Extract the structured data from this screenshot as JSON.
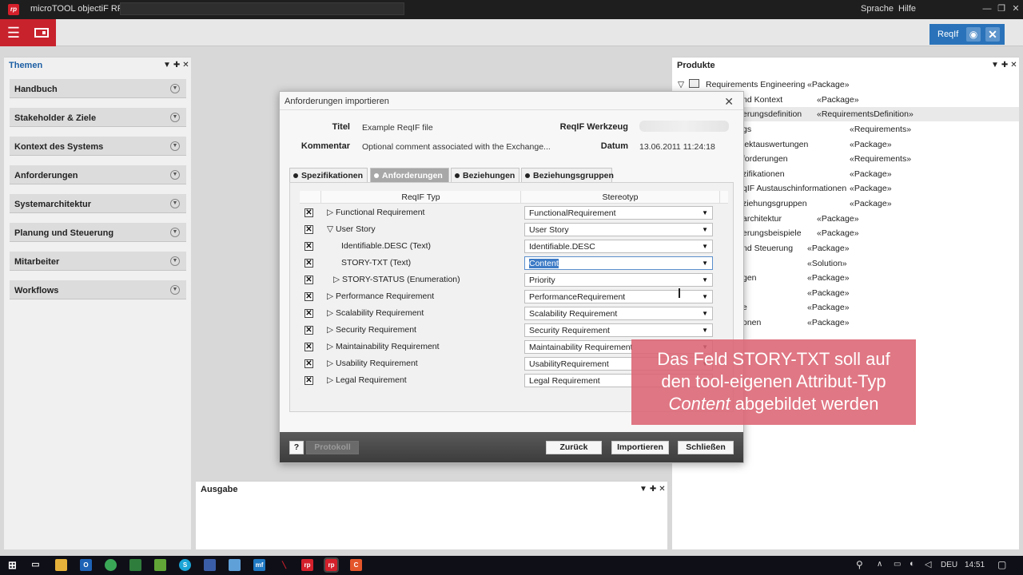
{
  "app": {
    "title": "microTOOL objectiF RPM",
    "logo": "rp"
  },
  "titlebar": {
    "menu_language": "Sprache",
    "menu_help": "Hilfe"
  },
  "toolbar": {
    "reqif_tab": "ReqIf"
  },
  "themen": {
    "title": "Themen",
    "items": [
      {
        "label": "Handbuch"
      },
      {
        "label": "Stakeholder & Ziele"
      },
      {
        "label": "Kontext des Systems"
      },
      {
        "label": "Anforderungen"
      },
      {
        "label": "Systemarchitektur"
      },
      {
        "label": "Planung und Steuerung"
      },
      {
        "label": "Mitarbeiter"
      },
      {
        "label": "Workflows"
      }
    ]
  },
  "produkte": {
    "title": "Produkte",
    "rows": [
      {
        "name": "Requirements Engineering",
        "stereo": "«Package»"
      },
      {
        "name": "nd Kontext",
        "stereo": "«Package»"
      },
      {
        "name": "erungsdefinition",
        "stereo": "«RequirementsDefinition»"
      },
      {
        "name": "gs",
        "stereo": "«Requirements»"
      },
      {
        "name": "jektauswertungen",
        "stereo": "«Package»"
      },
      {
        "name": "forderungen",
        "stereo": "«Requirements»"
      },
      {
        "name": "zifikationen",
        "stereo": "«Package»"
      },
      {
        "name": "qIF Austauschinformationen",
        "stereo": "«Package»"
      },
      {
        "name": "ziehungsgruppen",
        "stereo": "«Package»"
      },
      {
        "name": "architektur",
        "stereo": "«Package»"
      },
      {
        "name": "erungsbeispiele",
        "stereo": "«Package»"
      },
      {
        "name": "nd Steuerung",
        "stereo": "«Package»"
      },
      {
        "name": "",
        "stereo": "«Solution»"
      },
      {
        "name": "gen",
        "stereo": "«Package»"
      },
      {
        "name": "",
        "stereo": "«Package»"
      },
      {
        "name": "e",
        "stereo": "«Package»"
      },
      {
        "name": "onen",
        "stereo": "«Package»"
      }
    ]
  },
  "ausgabe": {
    "title": "Ausgabe"
  },
  "dialog": {
    "title": "Anforderungen importieren",
    "fields": {
      "title_label": "Titel",
      "title_value": "Example ReqIF file",
      "comment_label": "Kommentar",
      "comment_value": "Optional comment associated with the Exchange...",
      "tool_label": "ReqIF Werkzeug",
      "date_label": "Datum",
      "date_value": "13.06.2011 11:24:18"
    },
    "tabs": [
      {
        "label": "Spezifikationen"
      },
      {
        "label": "Anforderungen",
        "active": true
      },
      {
        "label": "Beziehungen"
      },
      {
        "label": "Beziehungsgruppen"
      }
    ],
    "table": {
      "col_type": "ReqIF Typ",
      "col_stereo": "Stereotyp",
      "rows": [
        {
          "type": "▷ Functional Requirement",
          "stereo": "FunctionalRequirement"
        },
        {
          "type": "▽ User Story",
          "stereo": "User Story"
        },
        {
          "type": "Identifiable.DESC (Text)",
          "stereo": "Identifiable.DESC"
        },
        {
          "type": "STORY-TXT (Text)",
          "stereo": "Content"
        },
        {
          "type": "▷ STORY-STATUS (Enumeration)",
          "stereo": "Priority"
        },
        {
          "type": "▷ Performance Requirement",
          "stereo": "PerformanceRequirement"
        },
        {
          "type": "▷ Scalability Requirement",
          "stereo": "Scalability Requirement"
        },
        {
          "type": "▷ Security Requirement",
          "stereo": "Security Requirement"
        },
        {
          "type": "▷ Maintainability Requirement",
          "stereo": "Maintainability Requirement"
        },
        {
          "type": "▷ Usability Requirement",
          "stereo": "UsabilityRequirement"
        },
        {
          "type": "▷ Legal Requirement",
          "stereo": "Legal Requirement"
        }
      ]
    },
    "footer": {
      "help": "?",
      "protokoll": "Protokoll",
      "back": "Zurück",
      "import": "Importieren",
      "close": "Schließen"
    }
  },
  "tooltip": {
    "line1": "Das Feld STORY-TXT soll auf",
    "line2": "den tool-eigenen Attribut-Typ",
    "line3_em": "Content",
    "line3_rest": " abgebildet werden"
  },
  "taskbar": {
    "lang": "DEU",
    "time": "14:51"
  }
}
